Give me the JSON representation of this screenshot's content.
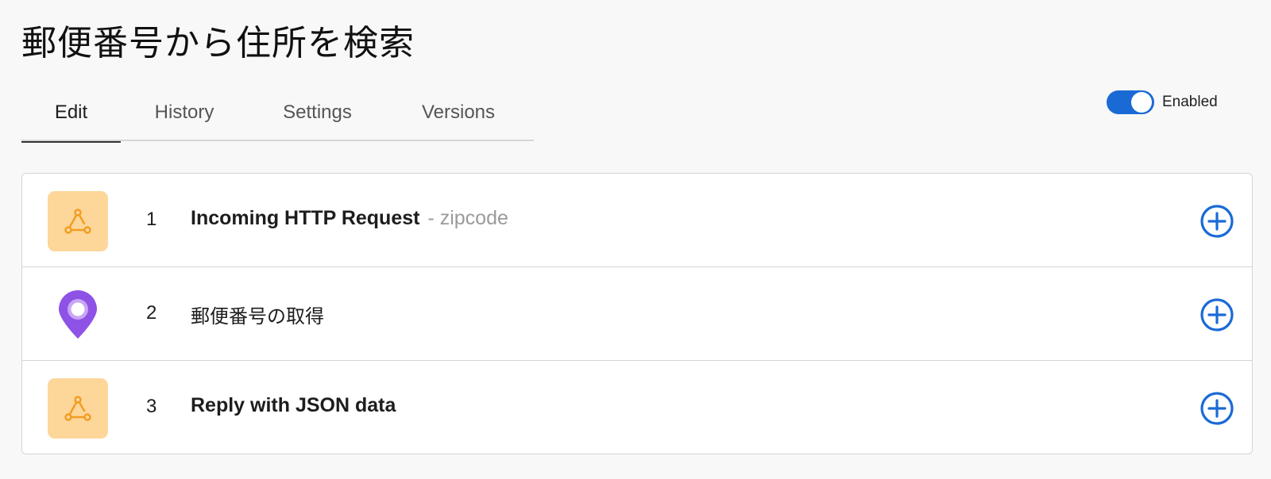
{
  "page": {
    "title": "郵便番号から住所を検索"
  },
  "tabs": [
    {
      "label": "Edit",
      "active": true
    },
    {
      "label": "History",
      "active": false
    },
    {
      "label": "Settings",
      "active": false
    },
    {
      "label": "Versions",
      "active": false
    }
  ],
  "toggle": {
    "label": "Enabled",
    "on": true,
    "color": "#1a6ad6"
  },
  "steps": [
    {
      "number": "1",
      "title": "Incoming HTTP Request",
      "subtitle": "- zipcode",
      "icon": "webhook-icon"
    },
    {
      "number": "2",
      "title": "郵便番号の取得",
      "subtitle": "",
      "icon": "location-pin-icon"
    },
    {
      "number": "3",
      "title": "Reply with JSON data",
      "subtitle": "",
      "icon": "webhook-icon"
    }
  ],
  "colors": {
    "accent": "#1a6ad6",
    "webhook_bg": "#fdd69a",
    "webhook_fg": "#f29c1f",
    "pin": "#8e52e6"
  }
}
